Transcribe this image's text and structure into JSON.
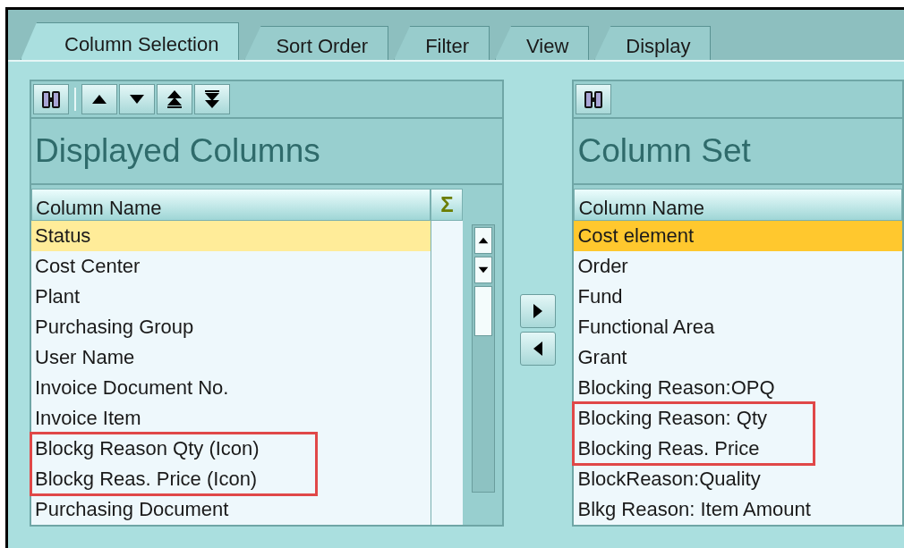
{
  "tabs": [
    {
      "label": "Column Selection",
      "selected": true
    },
    {
      "label": "Sort Order",
      "selected": false
    },
    {
      "label": "Filter",
      "selected": false
    },
    {
      "label": "View",
      "selected": false
    },
    {
      "label": "Display",
      "selected": false
    }
  ],
  "displayed_columns": {
    "title": "Displayed Columns",
    "header": "Column Name",
    "sum_header": "Σ",
    "focused": false,
    "items": [
      {
        "label": "Status",
        "selected": true,
        "highlighted": false
      },
      {
        "label": "Cost Center",
        "selected": false,
        "highlighted": false
      },
      {
        "label": "Plant",
        "selected": false,
        "highlighted": false
      },
      {
        "label": "Purchasing Group",
        "selected": false,
        "highlighted": false
      },
      {
        "label": "User Name",
        "selected": false,
        "highlighted": false
      },
      {
        "label": "Invoice Document No.",
        "selected": false,
        "highlighted": false
      },
      {
        "label": "Invoice Item",
        "selected": false,
        "highlighted": false
      },
      {
        "label": "Blockg Reason Qty (Icon)",
        "selected": false,
        "highlighted": true
      },
      {
        "label": "Blockg Reas. Price (Icon)",
        "selected": false,
        "highlighted": true
      },
      {
        "label": "Purchasing Document",
        "selected": false,
        "highlighted": false
      }
    ]
  },
  "column_set": {
    "title": "Column Set",
    "header": "Column Name",
    "focused": true,
    "items": [
      {
        "label": "Cost element",
        "selected": true,
        "highlighted": false
      },
      {
        "label": "Order",
        "selected": false,
        "highlighted": false
      },
      {
        "label": "Fund",
        "selected": false,
        "highlighted": false
      },
      {
        "label": "Functional Area",
        "selected": false,
        "highlighted": false
      },
      {
        "label": "Grant",
        "selected": false,
        "highlighted": false
      },
      {
        "label": "Blocking Reason:OPQ",
        "selected": false,
        "highlighted": false
      },
      {
        "label": "Blocking Reason: Qty",
        "selected": false,
        "highlighted": true
      },
      {
        "label": "Blocking Reas. Price",
        "selected": false,
        "highlighted": true
      },
      {
        "label": "BlockReason:Quality",
        "selected": false,
        "highlighted": false
      },
      {
        "label": "Blkg Reason: Item Amount",
        "selected": false,
        "highlighted": false
      }
    ]
  }
}
